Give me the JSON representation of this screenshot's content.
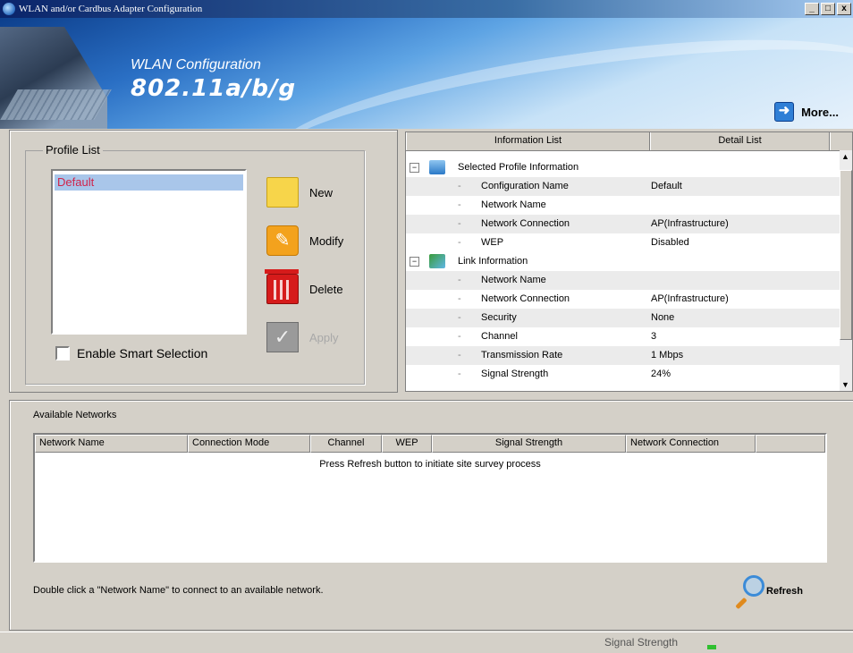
{
  "window": {
    "title": "WLAN and/or Cardbus Adapter Configuration",
    "controls": [
      "_",
      "□",
      "x"
    ]
  },
  "banner": {
    "title": "WLAN Configuration",
    "subtitle": "802.11a/b/g",
    "more_label": "More..."
  },
  "profile": {
    "legend": "Profile List",
    "items": [
      "Default"
    ],
    "selected": "Default",
    "smart_selection_label": "Enable Smart Selection",
    "smart_selection_checked": false,
    "buttons": {
      "new": "New",
      "modify": "Modify",
      "delete": "Delete",
      "apply": "Apply"
    }
  },
  "info": {
    "headers": [
      "Information List",
      "Detail List"
    ],
    "selected_profile": {
      "label": "Selected Profile Information",
      "rows": [
        {
          "name": "Configuration Name",
          "value": "Default"
        },
        {
          "name": "Network Name",
          "value": ""
        },
        {
          "name": "Network Connection",
          "value": "AP(Infrastructure)"
        },
        {
          "name": "WEP",
          "value": "Disabled"
        }
      ]
    },
    "link": {
      "label": "Link Information",
      "rows": [
        {
          "name": "Network Name",
          "value": ""
        },
        {
          "name": "Network Connection",
          "value": "AP(Infrastructure)"
        },
        {
          "name": "Security",
          "value": "None"
        },
        {
          "name": "Channel",
          "value": "3"
        },
        {
          "name": "Transmission Rate",
          "value": "1 Mbps"
        },
        {
          "name": "Signal Strength",
          "value": "24%"
        }
      ]
    }
  },
  "networks": {
    "title": "Available Networks",
    "columns": [
      "Network Name",
      "Connection Mode",
      "Channel",
      "WEP",
      "Signal Strength",
      "Network Connection"
    ],
    "empty_message": "Press Refresh button to initiate site survey process",
    "hint": "Double click a \"Network Name\" to connect to an available network.",
    "refresh_label": "Refresh"
  },
  "status": {
    "signal_label": "Signal Strength"
  }
}
